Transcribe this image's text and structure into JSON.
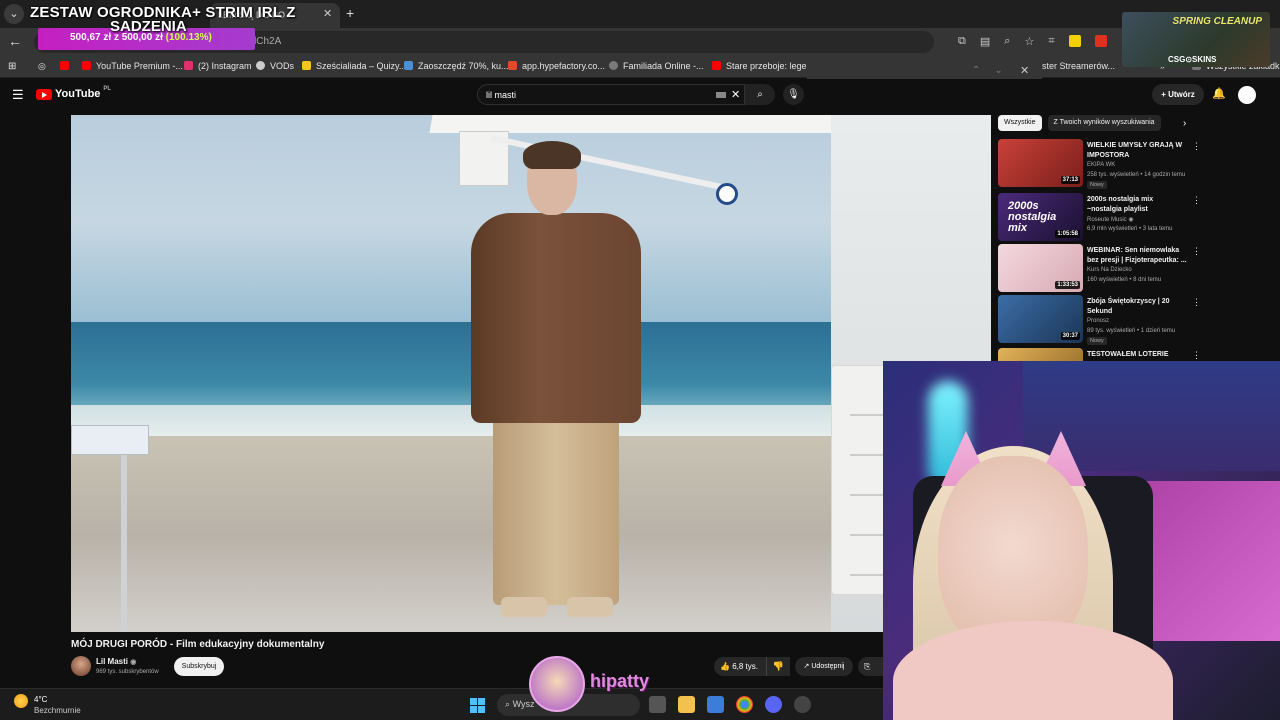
{
  "browser": {
    "active_tab_title": "LEM SIĘ DO PO",
    "address_partial": "lCh2A",
    "bookmarks": [
      {
        "label": "YouTube Premium -...",
        "color": "#ff0000"
      },
      {
        "label": "(2) Instagram",
        "color": "#e1306c"
      },
      {
        "label": "VODs",
        "color": "#cccccc"
      },
      {
        "label": "Sześcialiada – Quizy...",
        "color": "#f5c518"
      },
      {
        "label": "Zaoszczędź 70%, ku...",
        "color": "#4a90d9"
      },
      {
        "label": "app.hypefactory.co...",
        "color": "#e04a2a"
      },
      {
        "label": "Familiada Online -...",
        "color": "#7a7a7a"
      },
      {
        "label": "Stare przeboje: lege...",
        "color": "#ff0000"
      }
    ],
    "bookmarks_right": "ster Streamerów...",
    "bookmarks_all": "Wszystkie zakładki"
  },
  "donation_goal": {
    "title_line1": "ZESTAW OGRODNIKA+ STRIM IRL Z",
    "title_line2": "SADZENIA",
    "current": "500,67 zł",
    "separator": "z",
    "target": "500,00 zł",
    "percent": "(100.13%)"
  },
  "spring_overlay": {
    "title": "SPRING CLEANUP",
    "sponsor": "CSG⊙SKINS"
  },
  "youtube": {
    "logo_text": "YouTube",
    "region": "PL",
    "search_query": "lil masti",
    "create_label": "Utwórz"
  },
  "video": {
    "title": "MÓJ DRUGI PORÓD - Film edukacyjny dokumentalny",
    "channel": "Lil Masti",
    "subscribers": "969 tys. subskrybentów",
    "subscribe_label": "Subskrybuj",
    "likes": "6,8 tys.",
    "share_label": "Udostępnij"
  },
  "sidebar": {
    "chips": [
      "Wszystkie",
      "Z Twoich wyników wyszukiwania"
    ],
    "items": [
      {
        "title": "WIELKIE UMYSŁY GRAJĄ W IMPOSTORA",
        "channel": "EKIPA WK",
        "meta": "258 tys. wyświetleń • 14 godzin temu",
        "badge": "Nowy",
        "duration": "37:13",
        "thumb": "#b8322c"
      },
      {
        "title": "2000s nostalgia mix ~nostalgia playlist",
        "channel": "Roseute Music",
        "meta": "6,9 mln wyświetleń • 3 lata temu",
        "badge": "",
        "duration": "1:05:58",
        "thumb": "#3b1f5e",
        "thumb_text": "2000s nostalgia mix"
      },
      {
        "title": "WEBINAR: Sen niemowlaka bez presji | Fizjoterapeutka: ...",
        "channel": "Kurs Na Dziecko",
        "meta": "160 wyświetleń • 8 dni temu",
        "badge": "",
        "duration": "1:33:53",
        "thumb": "#e9c8cf"
      },
      {
        "title": "Zbója Świętokrzyscy | 20 Sekund",
        "channel": "Pronosz",
        "meta": "89 tys. wyświetleń • 1 dzień temu",
        "badge": "Nowy",
        "duration": "30:37",
        "thumb": "#2f5d8a"
      },
      {
        "title": "TESTOWAŁEM LOTERIE PRZEZ",
        "channel": "",
        "meta": "",
        "badge": "",
        "duration": "",
        "thumb": "#d9a64a"
      }
    ]
  },
  "overlay_user": {
    "name": "hipatty"
  },
  "taskbar": {
    "temperature": "4°C",
    "weather": "Bezchmurnie",
    "search_placeholder": "Wysz"
  }
}
